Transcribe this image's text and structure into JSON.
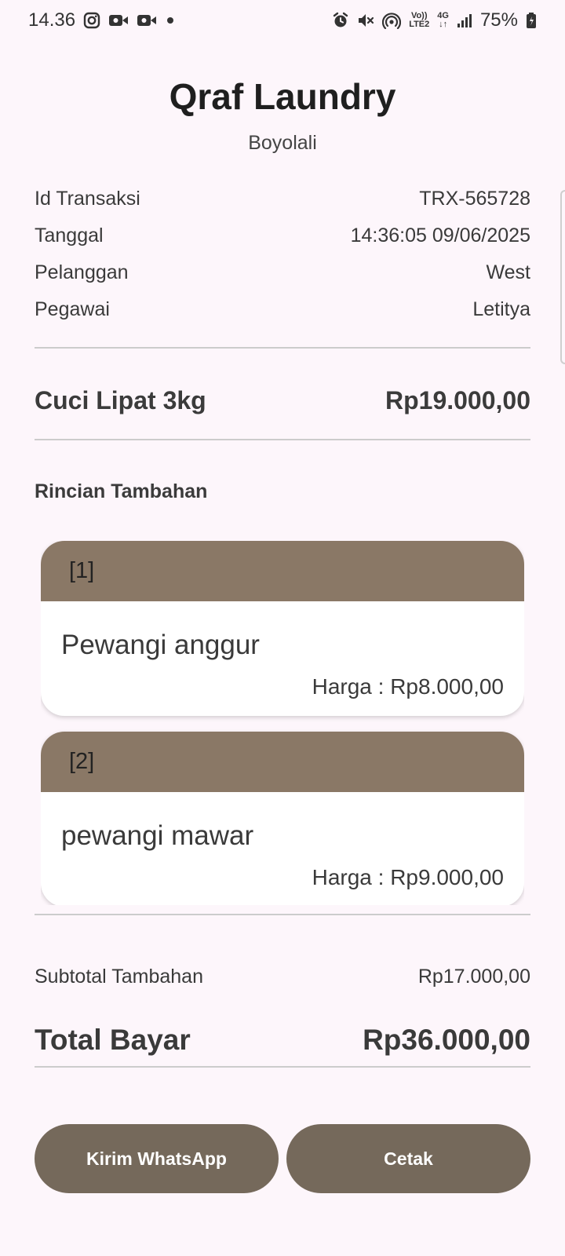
{
  "status_bar": {
    "time": "14.36",
    "battery": "75%",
    "net_volte": "Vo))\nLTE2",
    "net_4g": "4G"
  },
  "header": {
    "shop_name": "Qraf Laundry",
    "city": "Boyolali"
  },
  "transaction": [
    {
      "label": "Id Transaksi",
      "value": "TRX-565728"
    },
    {
      "label": "Tanggal",
      "value": "14:36:05 09/06/2025"
    },
    {
      "label": "Pelanggan",
      "value": "West"
    },
    {
      "label": "Pegawai",
      "value": "Letitya"
    }
  ],
  "service": {
    "name": "Cuci Lipat 3kg",
    "price": "Rp19.000,00"
  },
  "extras": {
    "title": "Rincian Tambahan",
    "items": [
      {
        "index": "[1]",
        "name": "Pewangi anggur",
        "price": "Harga : Rp8.000,00"
      },
      {
        "index": "[2]",
        "name": "pewangi mawar",
        "price": "Harga : Rp9.000,00"
      }
    ]
  },
  "summary": {
    "subtotal_label": "Subtotal Tambahan",
    "subtotal_value": "Rp17.000,00",
    "total_label": "Total Bayar",
    "total_value": "Rp36.000,00"
  },
  "actions": {
    "whatsapp_label": "Kirim WhatsApp",
    "print_label": "Cetak"
  },
  "colors": {
    "background": "#fdf6fb",
    "card_header": "#8a7866",
    "button": "#75695b"
  }
}
